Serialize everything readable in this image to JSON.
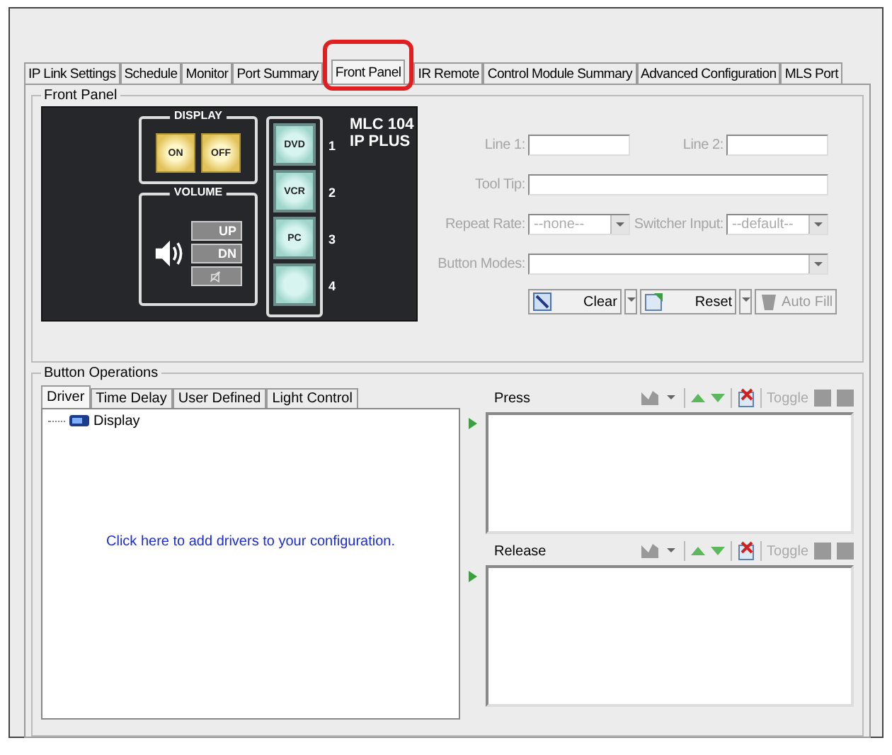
{
  "tabs": [
    {
      "label": "IP Link Settings",
      "selected": false
    },
    {
      "label": "Schedule",
      "selected": false
    },
    {
      "label": "Monitor",
      "selected": false
    },
    {
      "label": "Port Summary",
      "selected": false
    },
    {
      "label": "Front Panel",
      "selected": true
    },
    {
      "label": "IR Remote",
      "selected": false
    },
    {
      "label": "Control Module Summary",
      "selected": false
    },
    {
      "label": "Advanced Configuration",
      "selected": false
    },
    {
      "label": "MLS Port",
      "selected": false
    }
  ],
  "front_panel": {
    "title": "Front Panel",
    "device": {
      "display_title": "DISPLAY",
      "display_buttons": [
        "ON",
        "OFF"
      ],
      "volume_title": "VOLUME",
      "volume_buttons": [
        "UP",
        "DN"
      ],
      "model": [
        "MLC 104",
        "IP PLUS"
      ],
      "inputs": [
        {
          "label": "DVD",
          "number": "1"
        },
        {
          "label": "VCR",
          "number": "2"
        },
        {
          "label": "PC",
          "number": "3"
        },
        {
          "number": "4"
        }
      ]
    },
    "fields": [
      {
        "kind": "text",
        "label": "Line 1:",
        "wide": false
      },
      {
        "kind": "text",
        "label": "Line 2:",
        "wide": false
      },
      {
        "kind": "text",
        "label": "Tool Tip:",
        "wide": true
      },
      {
        "kind": "select",
        "label": "Repeat Rate:",
        "value": "--none--",
        "wide": false
      },
      {
        "kind": "select",
        "label": "Switcher Input:",
        "value": "--default--",
        "wide": false
      },
      {
        "kind": "select",
        "label": "Button Modes:",
        "wide": true
      }
    ],
    "actions": [
      {
        "label": "Clear",
        "kind": "clear",
        "disabled": false
      },
      {
        "label": "Reset",
        "kind": "reset",
        "disabled": false
      },
      {
        "label": "Auto Fill",
        "kind": "autofill",
        "disabled": true
      }
    ]
  },
  "button_operations": {
    "title": "Button Operations",
    "tabs": [
      {
        "label": "Driver",
        "selected": true
      },
      {
        "label": "Time Delay",
        "selected": false
      },
      {
        "label": "User Defined",
        "selected": false
      },
      {
        "label": "Light Control",
        "selected": false
      }
    ],
    "tree": [
      {
        "label": "Display"
      }
    ],
    "hint": "Click here to add drivers to your configuration.",
    "lists": [
      {
        "label": "Press",
        "toggle": "Toggle"
      },
      {
        "label": "Release",
        "toggle": "Toggle"
      }
    ]
  }
}
